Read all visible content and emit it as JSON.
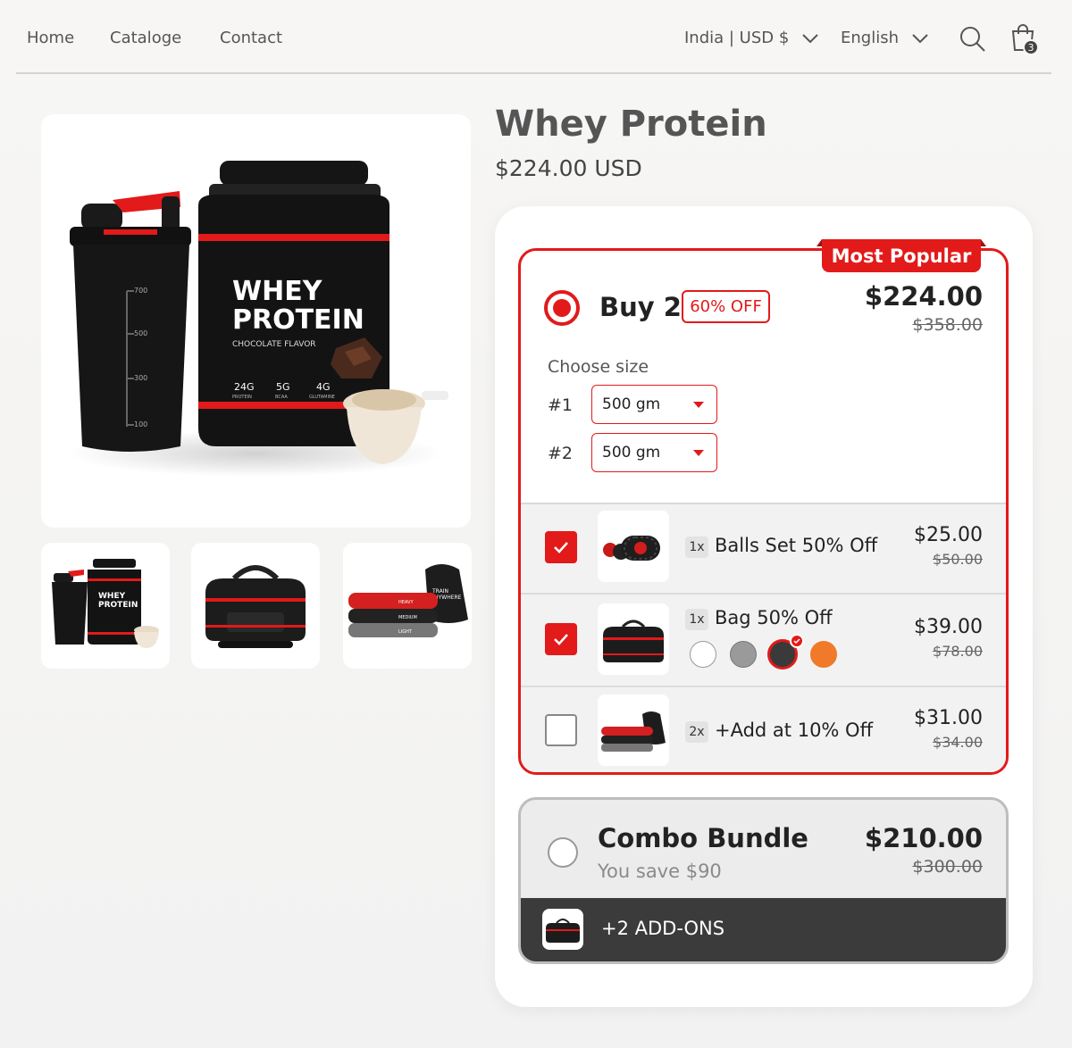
{
  "nav": {
    "links": [
      "Home",
      "Cataloge",
      "Contact"
    ],
    "region_selector": "India | USD $",
    "language_selector": "English",
    "cart_count": "3"
  },
  "gallery": {
    "main_image": {
      "shaker_scale": [
        "700",
        "500",
        "300",
        "100"
      ],
      "tub_title_line1": "WHEY",
      "tub_title_line2": "PROTEIN",
      "tub_flavor": "CHOCOLATE FLAVOR",
      "tub_stats": [
        {
          "value": "24G",
          "label": "PROTEIN"
        },
        {
          "value": "5G",
          "label": "BCAA"
        },
        {
          "value": "4G",
          "label": "GLUTAMINE"
        }
      ]
    },
    "thumb_labels": {
      "tub_line1": "WHEY",
      "tub_line2": "PROTEIN",
      "bag_print_line1": "TRAIN",
      "bag_print_line2": "ANYWHERE",
      "band_heavy": "HEAVY",
      "band_medium": "MEDIUM",
      "band_light": "LIGHT"
    }
  },
  "product": {
    "title": "Whey Protein",
    "price": "$224.00 USD"
  },
  "offer": {
    "ribbon": "Most Popular",
    "label": "Buy 2",
    "discount_badge": "60% OFF",
    "price": "$224.00",
    "old_price": "$358.00",
    "choose_size_label": "Choose size",
    "sizes": [
      {
        "label": "#1",
        "value": "500 gm"
      },
      {
        "label": "#2",
        "value": "500 gm"
      }
    ],
    "addons": [
      {
        "checked": true,
        "qty": "1x",
        "name": "Balls Set 50% Off",
        "price": "$25.00",
        "old_price": "$50.00"
      },
      {
        "checked": true,
        "qty": "1x",
        "name": "Bag 50% Off",
        "price": "$39.00",
        "old_price": "$78.00",
        "swatches": [
          "#ffffff",
          "#9a9a9a",
          "#3a3a3a",
          "#f07a2a"
        ],
        "selected_swatch": 2
      },
      {
        "checked": false,
        "qty": "2x",
        "name": "+Add at 10% Off",
        "price": "$31.00",
        "old_price": "$34.00"
      }
    ]
  },
  "combo": {
    "title": "Combo Bundle",
    "savings": "You save $90",
    "price": "$210.00",
    "old_price": "$300.00",
    "addons_label": "+2 ADD-ONS"
  },
  "colors": {
    "accent": "#e21a1a",
    "dark": "#3b3b3b"
  }
}
